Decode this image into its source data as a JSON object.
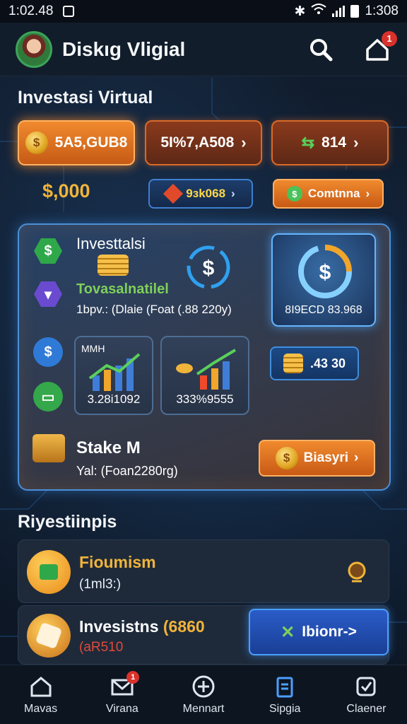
{
  "status_bar": {
    "time": "1:02.48",
    "right_time": "1:308"
  },
  "header": {
    "title": "Diskıg Vligial",
    "notification_count": "1"
  },
  "investasi": {
    "section_title": "Investasi Virtual",
    "top_buttons": [
      "5A5,GUB8",
      "5I%7,A508",
      "814"
    ],
    "balance": "$,000",
    "mid_pill": "9ɜk068",
    "continue_button": "Comtnna"
  },
  "panel": {
    "title": "Investtalsi",
    "subtitle": "Tovasalnatilel",
    "detail": "1bpv.: (Dlaie (Foat (.88 220y)",
    "card1_label": "MMH",
    "card1_value": "3.28i1092",
    "card2_value": "333%9555",
    "gauge_value": "8I9ECD 83.968",
    "percent_pill": ".43 30",
    "stake_title": "Stake M",
    "stake_detail": "Yal: (Foan2280rg)",
    "stake_button": "Biasyri"
  },
  "list": {
    "section_title": "Riyestiinpis",
    "items": [
      {
        "title": "Fioumism",
        "sub": "(1ml3:)"
      },
      {
        "title": "Invesistns",
        "title_accent": "(6860",
        "sub": "(aR510",
        "button": "Ibionr->"
      }
    ]
  },
  "nav": {
    "items": [
      "Mavas",
      "Virana",
      "Mennart",
      "Sipgia",
      "Claener"
    ],
    "badge": "1"
  },
  "colors": {
    "accent_orange": "#e8782a",
    "accent_blue": "#3f8ee0",
    "gold": "#f0b43a",
    "bg": "#0f1b2b"
  }
}
